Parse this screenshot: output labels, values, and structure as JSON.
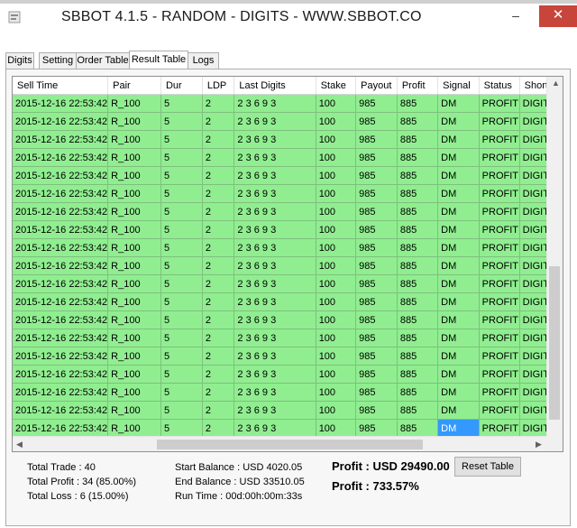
{
  "window": {
    "title": "SBBOT 4.1.5 - RANDOM - DIGITS - WWW.SBBOT.CO",
    "minimize_glyph": "–",
    "maximize_glyph": "☐",
    "close_glyph": "✕",
    "close_color": "#c7453a"
  },
  "tabs": [
    {
      "label": "Digits"
    },
    {
      "label": "Setting"
    },
    {
      "label": "Order Table"
    },
    {
      "label": "Result Table",
      "active": true
    },
    {
      "label": "Logs"
    }
  ],
  "grid": {
    "columns": [
      "Sell Time",
      "Pair",
      "Dur",
      "LDP",
      "Last Digits",
      "Stake",
      "Payout",
      "Profit",
      "Signal",
      "Status",
      "Short"
    ],
    "rows": [
      [
        "2015-12-16 22:53:42",
        "R_100",
        "5",
        "2",
        "2 3 6 9 3",
        "100",
        "985",
        "885",
        "DM",
        "PROFIT",
        "DIGIT"
      ],
      [
        "2015-12-16 22:53:42",
        "R_100",
        "5",
        "2",
        "2 3 6 9 3",
        "100",
        "985",
        "885",
        "DM",
        "PROFIT",
        "DIGIT"
      ],
      [
        "2015-12-16 22:53:42",
        "R_100",
        "5",
        "2",
        "2 3 6 9 3",
        "100",
        "985",
        "885",
        "DM",
        "PROFIT",
        "DIGIT"
      ],
      [
        "2015-12-16 22:53:42",
        "R_100",
        "5",
        "2",
        "2 3 6 9 3",
        "100",
        "985",
        "885",
        "DM",
        "PROFIT",
        "DIGIT"
      ],
      [
        "2015-12-16 22:53:42",
        "R_100",
        "5",
        "2",
        "2 3 6 9 3",
        "100",
        "985",
        "885",
        "DM",
        "PROFIT",
        "DIGIT"
      ],
      [
        "2015-12-16 22:53:42",
        "R_100",
        "5",
        "2",
        "2 3 6 9 3",
        "100",
        "985",
        "885",
        "DM",
        "PROFIT",
        "DIGIT"
      ],
      [
        "2015-12-16 22:53:42",
        "R_100",
        "5",
        "2",
        "2 3 6 9 3",
        "100",
        "985",
        "885",
        "DM",
        "PROFIT",
        "DIGIT"
      ],
      [
        "2015-12-16 22:53:42",
        "R_100",
        "5",
        "2",
        "2 3 6 9 3",
        "100",
        "985",
        "885",
        "DM",
        "PROFIT",
        "DIGIT"
      ],
      [
        "2015-12-16 22:53:42",
        "R_100",
        "5",
        "2",
        "2 3 6 9 3",
        "100",
        "985",
        "885",
        "DM",
        "PROFIT",
        "DIGIT"
      ],
      [
        "2015-12-16 22:53:42",
        "R_100",
        "5",
        "2",
        "2 3 6 9 3",
        "100",
        "985",
        "885",
        "DM",
        "PROFIT",
        "DIGIT"
      ],
      [
        "2015-12-16 22:53:42",
        "R_100",
        "5",
        "2",
        "2 3 6 9 3",
        "100",
        "985",
        "885",
        "DM",
        "PROFIT",
        "DIGIT"
      ],
      [
        "2015-12-16 22:53:42",
        "R_100",
        "5",
        "2",
        "2 3 6 9 3",
        "100",
        "985",
        "885",
        "DM",
        "PROFIT",
        "DIGIT"
      ],
      [
        "2015-12-16 22:53:42",
        "R_100",
        "5",
        "2",
        "2 3 6 9 3",
        "100",
        "985",
        "885",
        "DM",
        "PROFIT",
        "DIGIT"
      ],
      [
        "2015-12-16 22:53:42",
        "R_100",
        "5",
        "2",
        "2 3 6 9 3",
        "100",
        "985",
        "885",
        "DM",
        "PROFIT",
        "DIGIT"
      ],
      [
        "2015-12-16 22:53:42",
        "R_100",
        "5",
        "2",
        "2 3 6 9 3",
        "100",
        "985",
        "885",
        "DM",
        "PROFIT",
        "DIGIT"
      ],
      [
        "2015-12-16 22:53:42",
        "R_100",
        "5",
        "2",
        "2 3 6 9 3",
        "100",
        "985",
        "885",
        "DM",
        "PROFIT",
        "DIGIT"
      ],
      [
        "2015-12-16 22:53:42",
        "R_100",
        "5",
        "2",
        "2 3 6 9 3",
        "100",
        "985",
        "885",
        "DM",
        "PROFIT",
        "DIGIT"
      ],
      [
        "2015-12-16 22:53:42",
        "R_100",
        "5",
        "2",
        "2 3 6 9 3",
        "100",
        "985",
        "885",
        "DM",
        "PROFIT",
        "DIGIT"
      ],
      [
        "2015-12-16 22:53:42",
        "R_100",
        "5",
        "2",
        "2 3 6 9 3",
        "100",
        "985",
        "885",
        "DM",
        "PROFIT",
        "DIGIT"
      ]
    ],
    "row_color": "#90ee90",
    "selected_color": "#3399ff",
    "selected_cell": {
      "row": 18,
      "col": 8
    }
  },
  "summary": {
    "total_trade": "Total Trade : 40",
    "total_profit": "Total Profit : 34 (85.00%)",
    "total_loss": "Total Loss : 6 (15.00%)",
    "start_balance": "Start Balance : USD 4020.05",
    "end_balance": "End Balance : USD 33510.05",
    "run_time": "Run Time : 00d:00h:00m:33s",
    "profit_usd": "Profit : USD 29490.00",
    "profit_pct": "Profit : 733.57%",
    "reset_label": "Reset Table"
  }
}
